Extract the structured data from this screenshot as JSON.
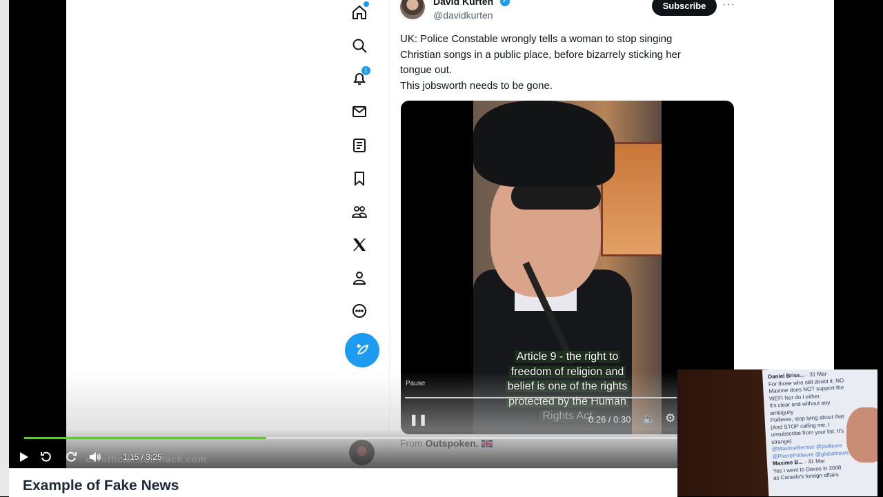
{
  "tweet": {
    "author_name": "David Kurten",
    "handle": "@davidkurten",
    "subscribe_label": "Subscribe",
    "more_label": "···",
    "text_lines": [
      "UK: Police Constable wrongly tells a woman to stop singing",
      "Christian songs in a public place, before bizarrely sticking her",
      "tongue out.",
      "This jobsworth needs to be gone."
    ],
    "from_label": "From",
    "from_source": "Outspoken."
  },
  "embedded_video": {
    "subtitle_lines": [
      "Article 9 - the right to",
      "freedom of religion and",
      "belief is one of the rights",
      "protected by the Human",
      "Rights Act"
    ],
    "pause_label": "Pause",
    "time": "0:26 / 0:30"
  },
  "nav": {
    "notification_count": "1",
    "icons": [
      "home-icon",
      "search-icon",
      "notifications-icon",
      "messages-icon",
      "lists-icon",
      "bookmarks-icon",
      "communities-icon",
      "x-logo-icon",
      "profile-icon",
      "more-icon"
    ]
  },
  "player": {
    "time": "1:15 / 3:25",
    "progress_fraction": 0.366,
    "watermark": "ccrofficial.substack.com"
  },
  "pip_phone": {
    "lines": [
      {
        "u": "Daniel Briss...",
        "t": " · 31 Mar"
      },
      {
        "t": "For those who still doubt it: NO"
      },
      {
        "t": "Maxime does NOT support the"
      },
      {
        "t": "WEF! Nor do I either."
      },
      {
        "t": "It's clear and without any"
      },
      {
        "t": "ambiguity"
      },
      {
        "t": "Poilievre, stop lying about that"
      },
      {
        "t": "(And STOP calling me. I"
      },
      {
        "t": "unsubscribe from your list. It's"
      },
      {
        "t": "strange)"
      },
      {
        "l": "@MaximeBernier @poilievre"
      },
      {
        "l": "@PierrePoilievre @globalnews"
      },
      {
        "t": " "
      },
      {
        "u": "Maxime B...",
        "t": " · 31 Mar"
      },
      {
        "t": "Yes I went to Davos in 2008"
      },
      {
        "t": "as Canada's foreign affairs"
      }
    ]
  },
  "caption": {
    "title": "Example of Fake News"
  },
  "colors": {
    "accent": "#1d9bf0",
    "progress": "#6bbf3a"
  }
}
